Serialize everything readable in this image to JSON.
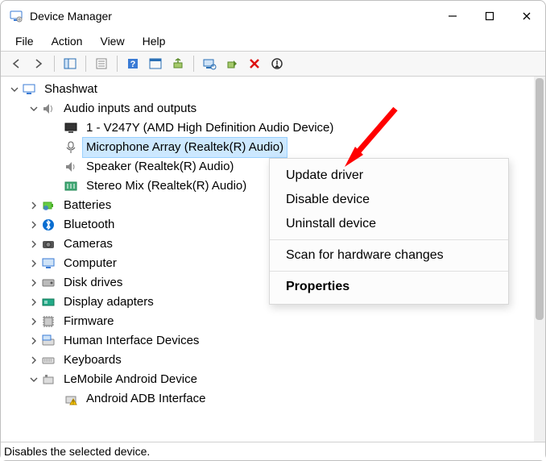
{
  "window": {
    "title": "Device Manager"
  },
  "menu": {
    "file": "File",
    "action": "Action",
    "view": "View",
    "help": "Help"
  },
  "tree": {
    "root": "Shashwat",
    "audio_category": "Audio inputs and outputs",
    "audio_items": {
      "monitor": "1 - V247Y (AMD High Definition Audio Device)",
      "mic": "Microphone Array (Realtek(R) Audio)",
      "speaker": "Speaker (Realtek(R) Audio)",
      "stereo": "Stereo Mix (Realtek(R) Audio)"
    },
    "batteries": "Batteries",
    "bluetooth": "Bluetooth",
    "cameras": "Cameras",
    "computer": "Computer",
    "disk": "Disk drives",
    "display": "Display adapters",
    "firmware": "Firmware",
    "hid": "Human Interface Devices",
    "keyboards": "Keyboards",
    "lemobile": "LeMobile Android Device",
    "lemobile_child": "Android ADB Interface"
  },
  "context_menu": {
    "update": "Update driver",
    "disable": "Disable device",
    "uninstall": "Uninstall device",
    "scan": "Scan for hardware changes",
    "properties": "Properties"
  },
  "status": "Disables the selected device."
}
